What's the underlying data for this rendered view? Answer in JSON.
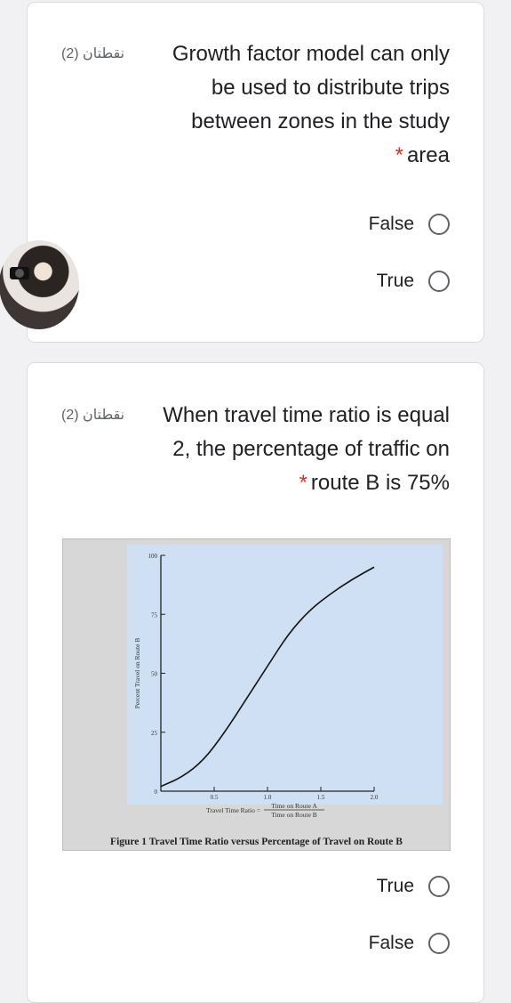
{
  "questions": [
    {
      "points": "(2) نقطتان",
      "lines": [
        "Growth factor model can only",
        "be used to distribute trips",
        "between zones in the study",
        "area"
      ],
      "required_marker": "*",
      "options": [
        {
          "label": "False"
        },
        {
          "label": "True"
        }
      ]
    },
    {
      "points": "(2) نقطتان",
      "lines": [
        "When travel time ratio is equal",
        "2, the percentage of traffic on",
        "route B is 75%"
      ],
      "required_marker": "*",
      "options": [
        {
          "label": "True"
        },
        {
          "label": "False"
        }
      ]
    }
  ],
  "figure": {
    "caption": "Figure 1 Travel Time Ratio versus Percentage of Travel on Route B",
    "ylabel": "Percent Travel on Route B",
    "xlabel_prefix": "Travel Time Ratio =",
    "x_numerator": "Time on Route A",
    "x_denominator": "Time on Route B",
    "y_ticks": [
      "100",
      "75",
      "50",
      "25",
      "0"
    ],
    "x_ticks": [
      "0.5",
      "1.0",
      "1.5",
      "2.0"
    ]
  },
  "chart_data": {
    "type": "line",
    "xlabel": "Travel Time Ratio = Time on Route A / Time on Route B",
    "ylabel": "Percent Travel on Route B",
    "xlim": [
      0,
      2.0
    ],
    "ylim": [
      0,
      100
    ],
    "series": [
      {
        "x": [
          0,
          0.2,
          0.4,
          0.6,
          0.8,
          1.0,
          1.2,
          1.4,
          1.6,
          1.8,
          2.0
        ],
        "y": [
          2,
          6,
          13,
          25,
          39,
          53,
          67,
          77,
          84,
          90,
          95
        ]
      }
    ]
  }
}
